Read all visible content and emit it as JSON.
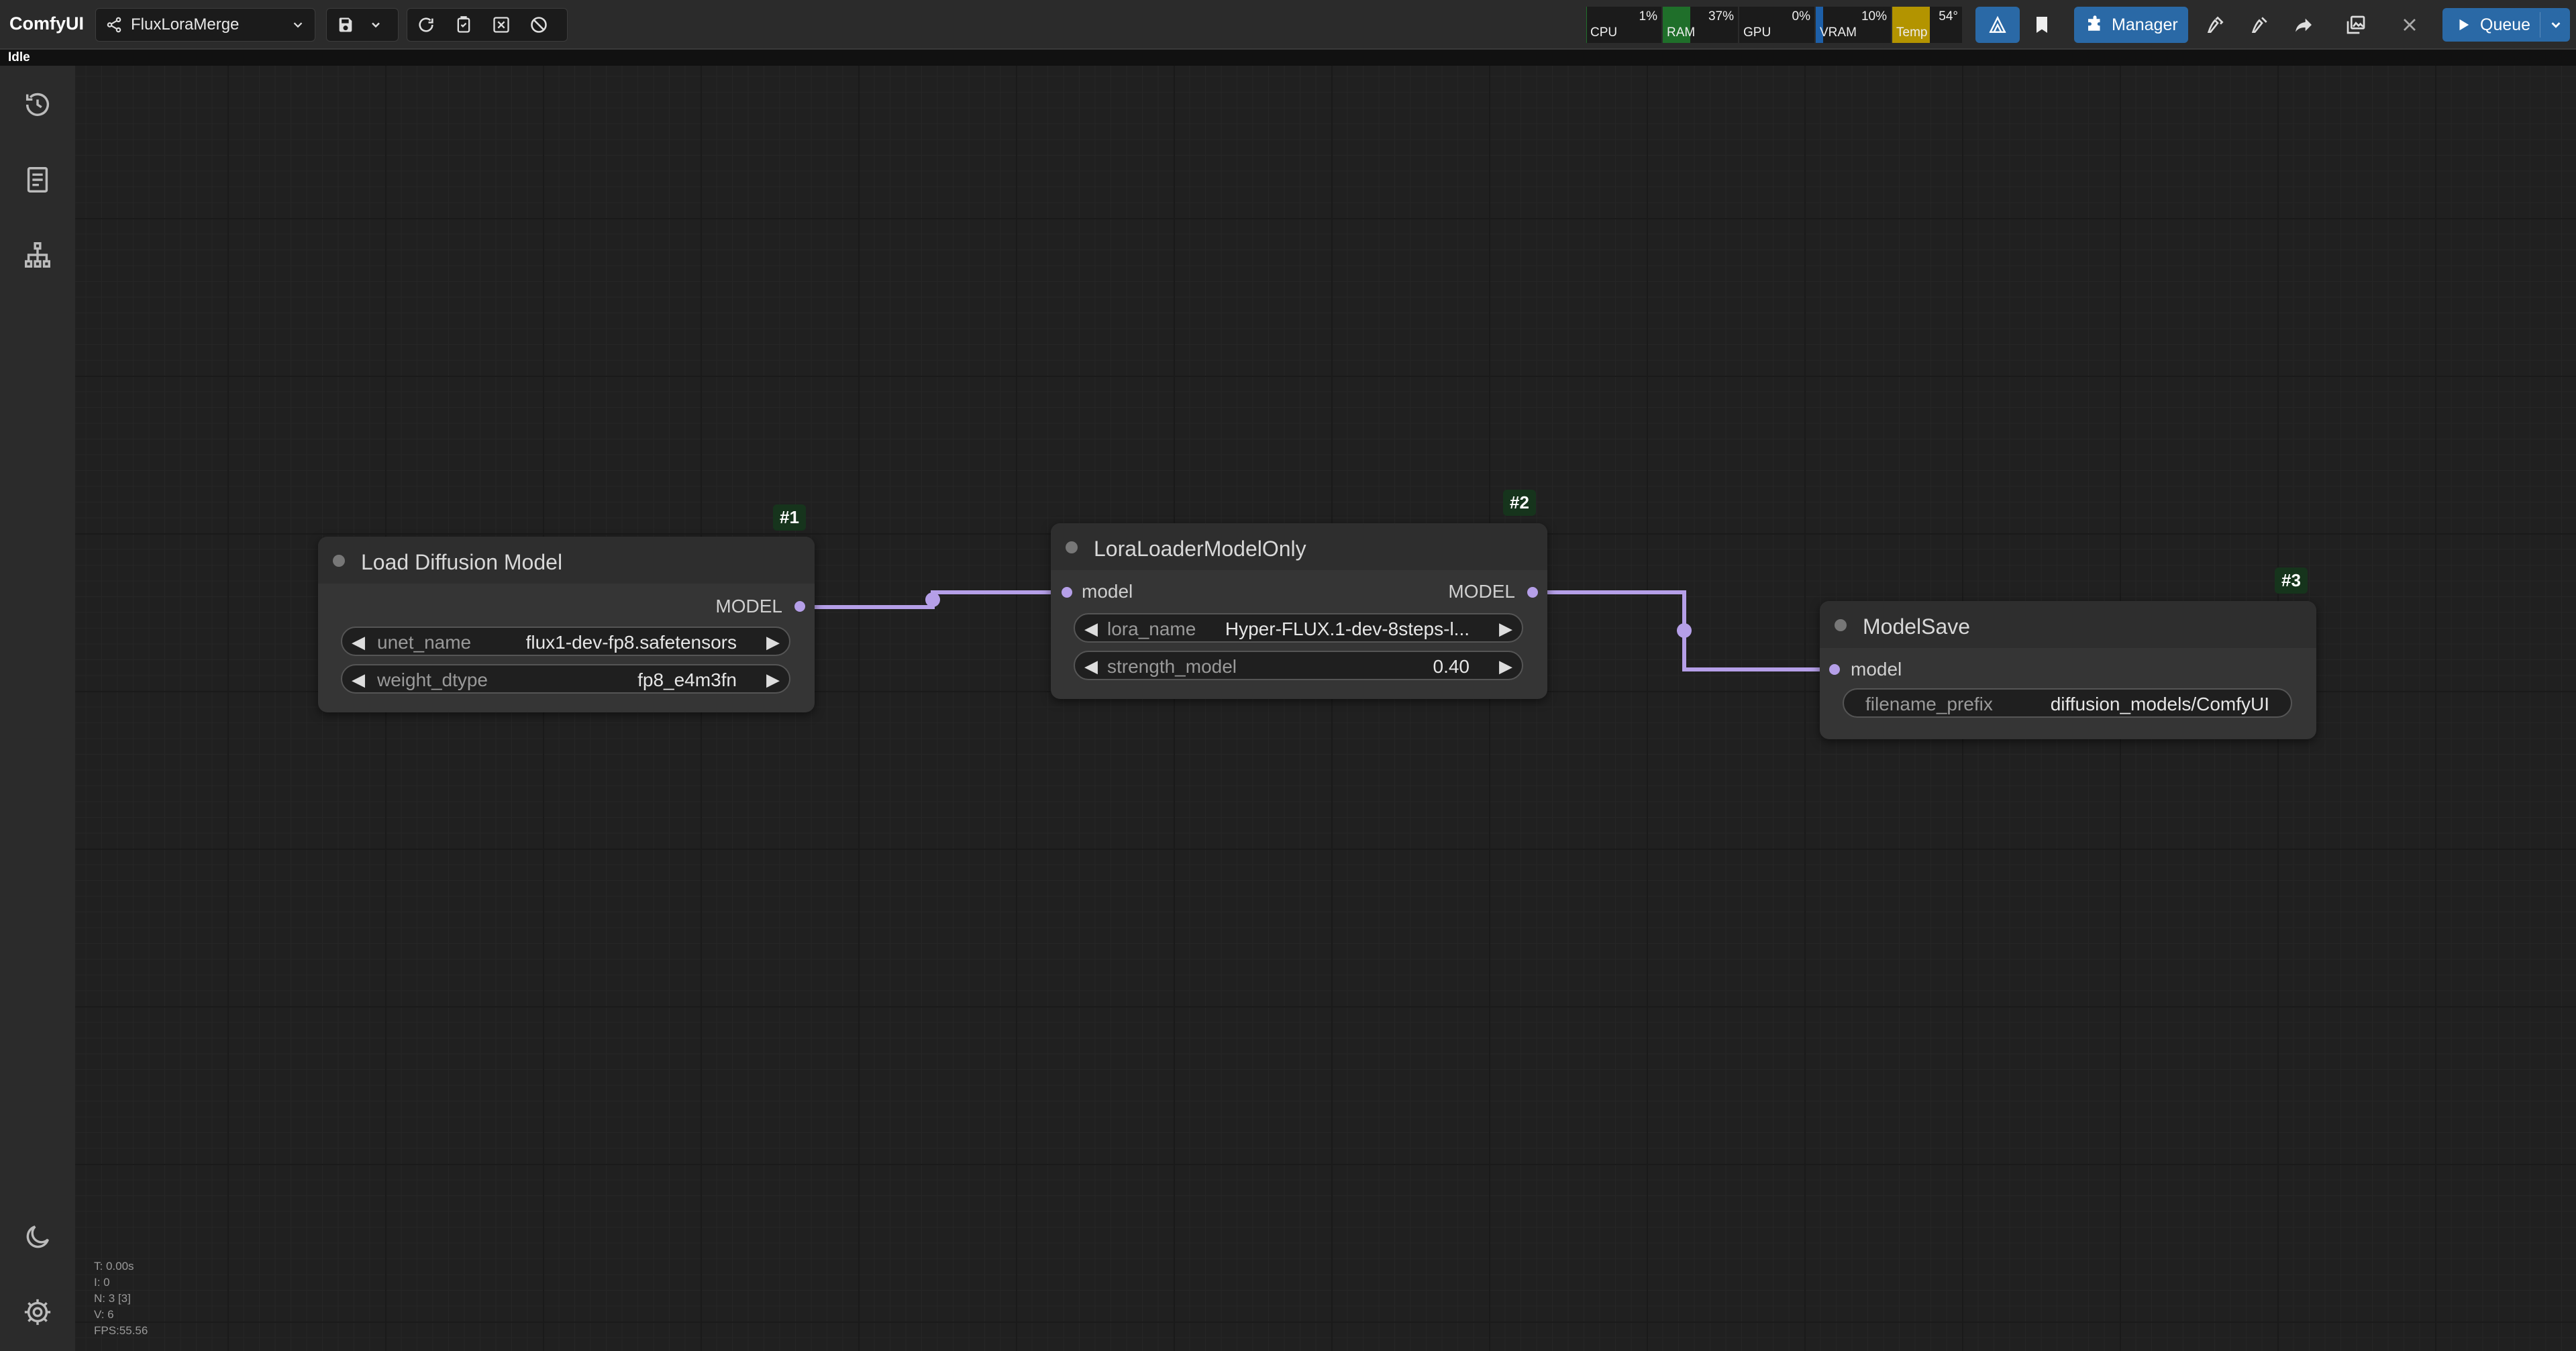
{
  "app": {
    "title": "ComfyUI",
    "status": "Idle"
  },
  "workflow": {
    "name": "FluxLoraMerge"
  },
  "monitors": [
    {
      "label": "CPU",
      "value": "1%",
      "fill": 0.01,
      "color": "#1f6f2a"
    },
    {
      "label": "RAM",
      "value": "37%",
      "fill": 0.37,
      "color": "#1f6f2a"
    },
    {
      "label": "GPU",
      "value": "0%",
      "fill": 0.0,
      "color": "#1f6f2a"
    },
    {
      "label": "VRAM",
      "value": "10%",
      "fill": 0.1,
      "color": "#1d5fa8"
    },
    {
      "label": "Temp",
      "value": "54°",
      "fill": 0.54,
      "color": "#b39400"
    }
  ],
  "toolbar": {
    "manager_label": "Manager",
    "queue_label": "Queue"
  },
  "nodes": [
    {
      "id": "#1",
      "title": "Load Diffusion Model",
      "output": "MODEL",
      "widgets": [
        {
          "label": "unet_name",
          "value": "flux1-dev-fp8.safetensors"
        },
        {
          "label": "weight_dtype",
          "value": "fp8_e4m3fn"
        }
      ]
    },
    {
      "id": "#2",
      "title": "LoraLoaderModelOnly",
      "input": "model",
      "output": "MODEL",
      "widgets": [
        {
          "label": "lora_name",
          "value": "Hyper-FLUX.1-dev-8steps-l..."
        },
        {
          "label": "strength_model",
          "value": "0.40"
        }
      ]
    },
    {
      "id": "#3",
      "title": "ModelSave",
      "input": "model",
      "widgets": [
        {
          "label": "filename_prefix",
          "value": "diffusion_models/ComfyUI"
        }
      ]
    }
  ],
  "stats": {
    "t": "T: 0.00s",
    "i": "I: 0",
    "n": "N: 3 [3]",
    "v": "V: 6",
    "fps": "FPS:55.56"
  },
  "colors": {
    "link": "#b59fe8",
    "accent": "#2a69a6"
  }
}
